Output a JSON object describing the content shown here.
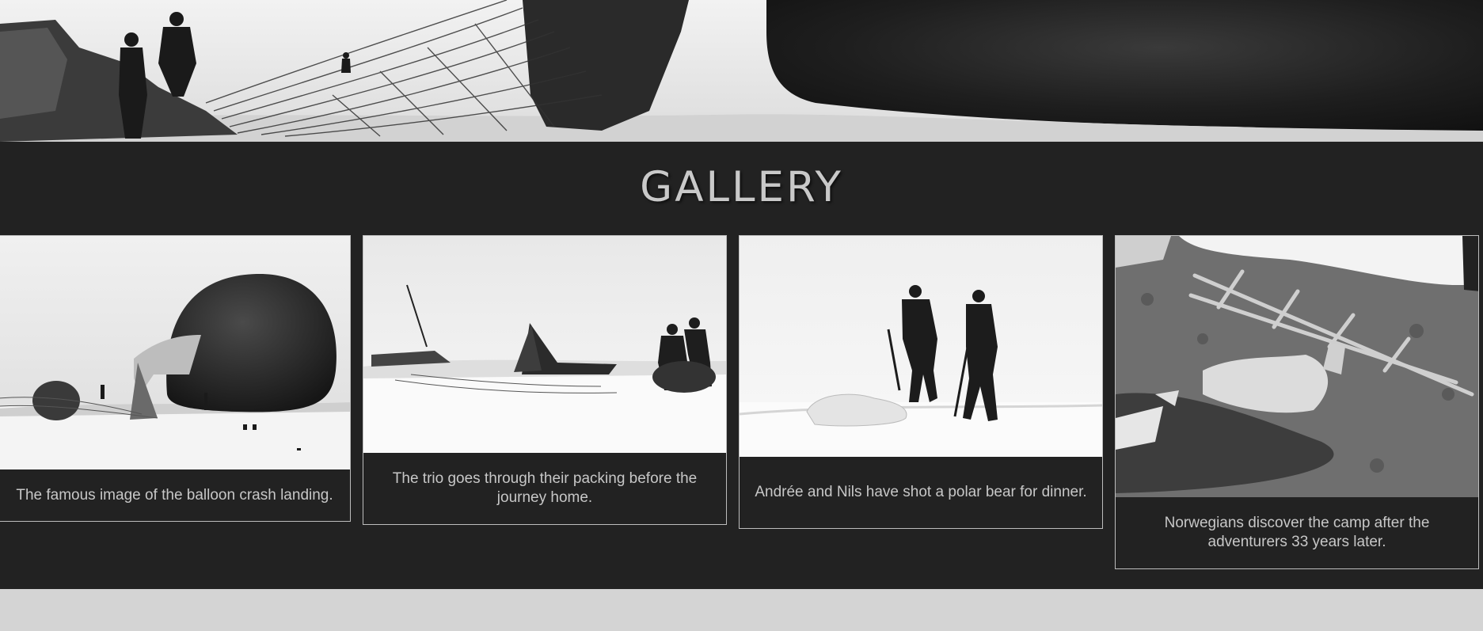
{
  "hero": {
    "image": "balloon-crash-panorama"
  },
  "gallery": {
    "title": "GALLERY",
    "items": [
      {
        "image": "balloon-crash-landing",
        "caption": "The famous image of the balloon crash landing."
      },
      {
        "image": "packing-sledges",
        "caption": "The trio goes through their packing before the journey home."
      },
      {
        "image": "polar-bear-hunt",
        "caption": "Andrée and Nils have shot a polar bear for dinner."
      },
      {
        "image": "camp-remains",
        "caption": "Norwegians discover the camp after the adventurers 33 years later."
      }
    ]
  },
  "colors": {
    "band": "#222222",
    "title": "#c9c9c9",
    "caption": "#c7c7c7",
    "border": "#bdbdbd",
    "page": "#d4d4d4"
  }
}
